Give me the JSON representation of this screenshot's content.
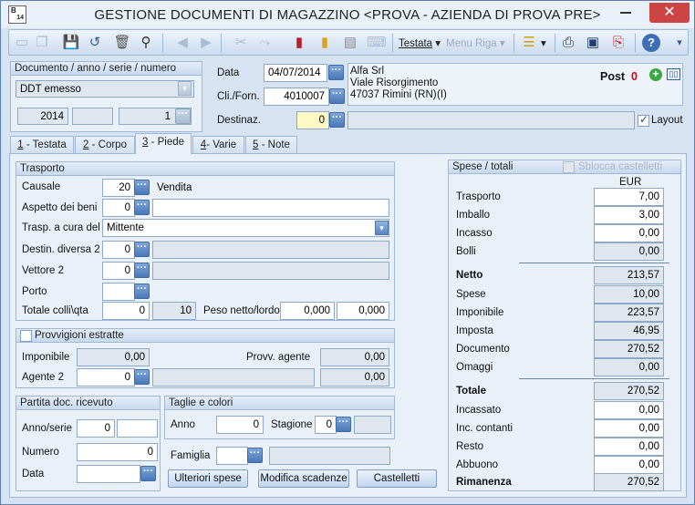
{
  "window": {
    "title": "GESTIONE DOCUMENTI DI MAGAZZINO <PROVA - AZIENDA DI PROVA PRE>",
    "app_icon_text": "B",
    "app_icon_sub": "14",
    "close_glyph": "✕",
    "min_glyph": ""
  },
  "toolbar": {
    "icons": [
      "new-icon",
      "copy-icon",
      "save-icon",
      "undo-icon",
      "delete-icon",
      "binoculars-icon",
      "prev-icon",
      "next-icon",
      "cut-icon",
      "unlink-icon",
      "book-red-icon",
      "book-yellow-icon",
      "document-icon",
      "keyboard-icon",
      "list-icon",
      "printer-icon",
      "monitor-icon",
      "pdf-icon",
      "help-icon"
    ],
    "testata_label": "Testata",
    "menu_riga_label": "Menu Riga",
    "dropdown_glyph": "▾"
  },
  "header": {
    "doc_panel_title": "Documento / anno / serie / numero",
    "doc_type": "DDT emesso",
    "anno": "2014",
    "serie": "",
    "numero": "1",
    "data_label": "Data",
    "data_value": "04/07/2014",
    "cliforn_label": "Cli./Forn.",
    "cliforn_value": "4010007",
    "destinaz_label": "Destinaz.",
    "destinaz_value": "0",
    "destinaz_desc": "",
    "customer_name": "Alfa Srl",
    "customer_street": "Viale Risorgimento",
    "customer_city": "47037 Rimini (RN)",
    "customer_country": "(I)",
    "post_label": "Post",
    "post_value": "0",
    "layout_label": "Layout",
    "layout_checked": true
  },
  "tabs": [
    {
      "key": "1",
      "label": " - Testata"
    },
    {
      "key": "2",
      "label": " - Corpo"
    },
    {
      "key": "3",
      "label": " - Piede"
    },
    {
      "key": "4",
      "label": "- Varie"
    },
    {
      "key": "5",
      "label": " - Note"
    }
  ],
  "trasporto": {
    "title": "Trasporto",
    "causale_label": "Causale",
    "causale_code": "20",
    "causale_desc": "Vendita",
    "aspetto_label": "Aspetto dei beni",
    "aspetto_code": "0",
    "aspetto_desc": "",
    "trasp_label": "Trasp. a cura del",
    "trasp_value": "Mittente",
    "destin_label": "Destin. diversa 2",
    "destin_code": "0",
    "vettore_label": "Vettore 2",
    "vettore_code": "0",
    "porto_label": "Porto",
    "porto_value": "",
    "colli_label": "Totale colli\\qta",
    "colli_value": "0",
    "qta_value": "10",
    "peso_label": "Peso netto/lordo",
    "peso_netto": "0,000",
    "peso_lordo": "0,000"
  },
  "provvigioni": {
    "title": "Provvigioni estratte",
    "imponibile_label": "Imponibile",
    "imponibile_value": "0,00",
    "provv_agente_label": "Provv. agente",
    "provv_agente_value": "0,00",
    "agente2_label": "Agente 2",
    "agente2_code": "0",
    "agente2_value": "0,00"
  },
  "partita": {
    "title": "Partita doc. ricevuto",
    "anno_label": "Anno/serie",
    "anno_value": "0",
    "serie_value": "",
    "numero_label": "Numero",
    "numero_value": "0",
    "data_label": "Data",
    "data_value": ""
  },
  "taglie": {
    "title": "Taglie e colori",
    "anno_label": "Anno",
    "anno_value": "0",
    "stagione_label": "Stagione",
    "stagione_value": "0"
  },
  "bottom": {
    "famiglia_label": "Famiglia",
    "ulteriori_label": "Ulteriori spese",
    "modifica_label": "Modifica scadenze",
    "castelletti_label": "Castelletti"
  },
  "spese": {
    "title": "Spese / totali",
    "sblocca_label": "Sblocca castelletti",
    "currency": "EUR",
    "rows1": [
      {
        "label": "Trasporto",
        "value": "7,00"
      },
      {
        "label": "Imballo",
        "value": "3,00"
      },
      {
        "label": "Incasso",
        "value": "0,00"
      },
      {
        "label": "Bolli",
        "value": "0,00"
      }
    ],
    "rows2": [
      {
        "label": "Netto",
        "value": "213,57"
      },
      {
        "label": "Spese",
        "value": "10,00"
      },
      {
        "label": "Imponibile",
        "value": "223,57"
      },
      {
        "label": "Imposta",
        "value": "46,95"
      },
      {
        "label": "Documento",
        "value": "270,52"
      },
      {
        "label": "Omaggi",
        "value": "0,00"
      }
    ],
    "rows3": [
      {
        "label": "Totale",
        "value": "270,52"
      },
      {
        "label": "Incassato",
        "value": "0,00"
      },
      {
        "label": "Inc. contanti",
        "value": "0,00"
      },
      {
        "label": "Resto",
        "value": "0,00"
      },
      {
        "label": "Abbuono",
        "value": "0,00"
      },
      {
        "label": "Rimanenza",
        "value": "270,52"
      }
    ]
  },
  "colors": {
    "accent": "#3e6aa6",
    "post_value": "#d0021b",
    "panel": "#e9f0f8"
  }
}
